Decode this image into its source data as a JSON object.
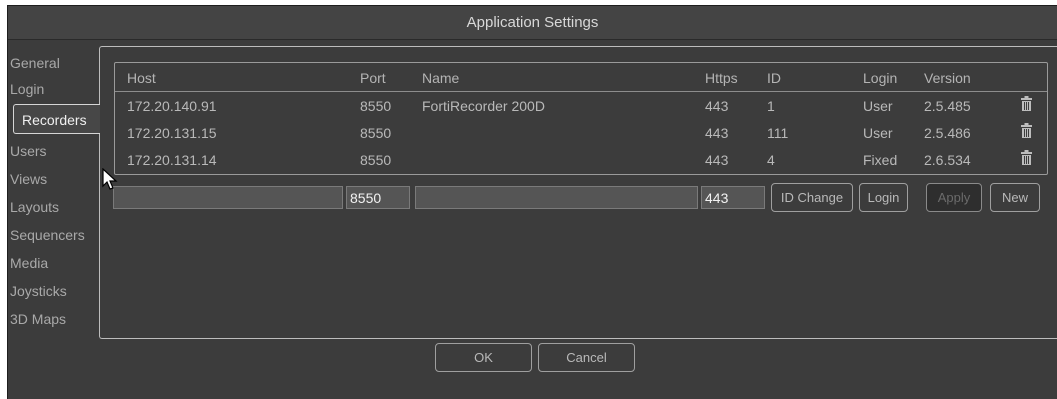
{
  "window": {
    "title": "Application Settings"
  },
  "tabs": [
    {
      "label": "General"
    },
    {
      "label": "Login"
    },
    {
      "label": "Recorders"
    },
    {
      "label": "Users"
    },
    {
      "label": "Views"
    },
    {
      "label": "Layouts"
    },
    {
      "label": "Sequencers"
    },
    {
      "label": "Media"
    },
    {
      "label": "Joysticks"
    },
    {
      "label": "3D Maps"
    }
  ],
  "active_tab": "Recorders",
  "table": {
    "columns": [
      "Host",
      "Port",
      "Name",
      "Https",
      "ID",
      "Login",
      "Version"
    ],
    "rows": [
      {
        "host": "172.20.140.91",
        "port": "8550",
        "name": "FortiRecorder 200D",
        "https": "443",
        "id": "1",
        "login": "User",
        "version": "2.5.485",
        "delete_icon": "trash-icon"
      },
      {
        "host": "172.20.131.15",
        "port": "8550",
        "name": "",
        "https": "443",
        "id": "111",
        "login": "User",
        "version": "2.5.486",
        "delete_icon": "trash-icon"
      },
      {
        "host": "172.20.131.14",
        "port": "8550",
        "name": "",
        "https": "443",
        "id": "4",
        "login": "Fixed",
        "version": "2.6.534",
        "delete_icon": "trash-icon"
      }
    ]
  },
  "editor": {
    "host_value": "",
    "port_value": "8550",
    "name_value": "",
    "https_value": "443",
    "id_change_label": "ID Change",
    "login_label": "Login",
    "apply_label": "Apply",
    "new_label": "New"
  },
  "footer": {
    "ok_label": "OK",
    "cancel_label": "Cancel"
  },
  "colors": {
    "background": "#3c3c3c",
    "titlebar": "#444444",
    "border": "#bdbdbd",
    "text": "#b9b9b9"
  }
}
